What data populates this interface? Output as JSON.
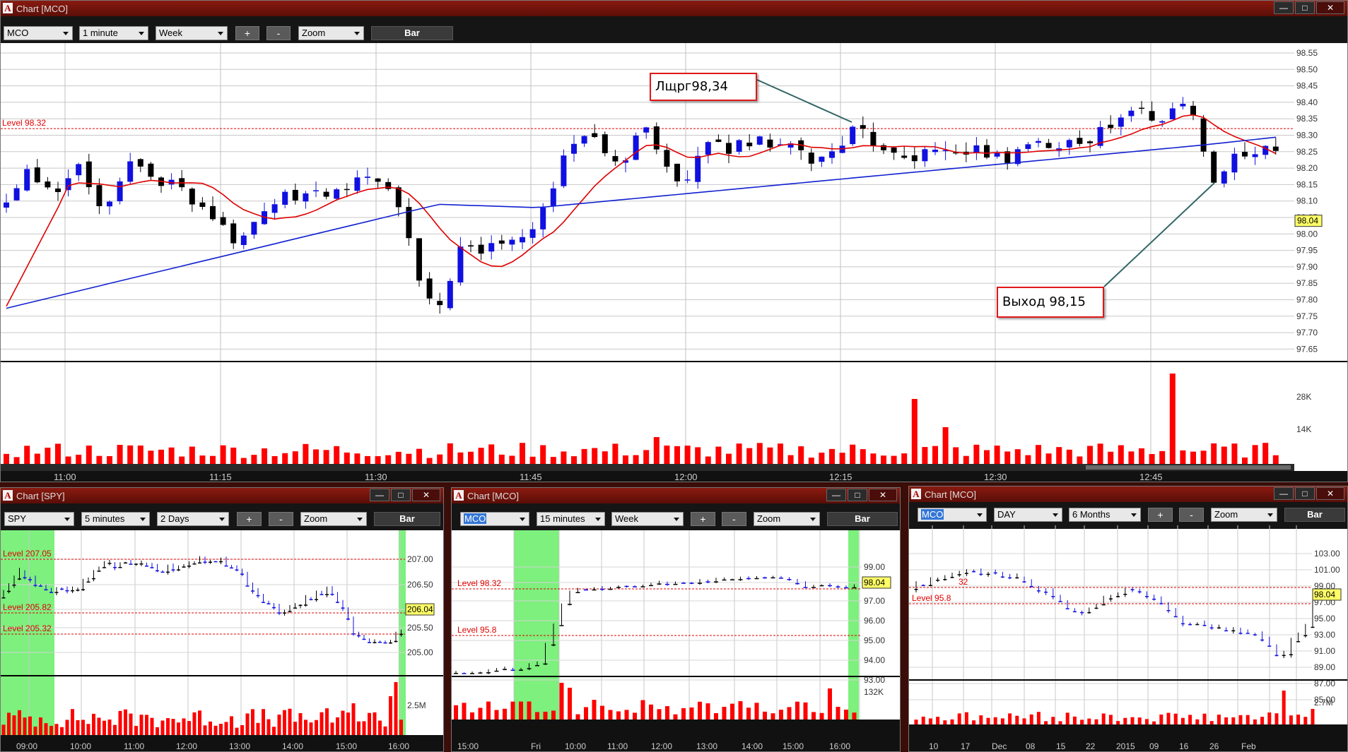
{
  "main": {
    "title": "Chart [MCO]",
    "symbol": "MCO",
    "interval": "1 minute",
    "range": "Week",
    "plus": "+",
    "minus": "-",
    "zoom": "Zoom",
    "bar": "Bar",
    "level_label": "Level 98.32",
    "price_labels": [
      "98.55",
      "98.50",
      "98.45",
      "98.40",
      "98.35",
      "98.30",
      "98.25",
      "98.20",
      "98.15",
      "98.10",
      "98.05",
      "98.00",
      "97.95",
      "97.90",
      "97.85",
      "97.80",
      "97.75",
      "97.70",
      "97.65"
    ],
    "current_price": "98.04",
    "volume_labels": [
      "28K",
      "14K"
    ],
    "time_labels": [
      "11:00",
      "11:15",
      "11:30",
      "11:45",
      "12:00",
      "12:15",
      "12:30",
      "12:45"
    ],
    "annotation_entry": "Лщрг98,34",
    "annotation_exit": "Выход 98,15"
  },
  "spy": {
    "title": "Chart [SPY]",
    "symbol": "SPY",
    "interval": "5 minutes",
    "range": "2 Days",
    "plus": "+",
    "minus": "-",
    "zoom": "Zoom",
    "bar": "Bar",
    "levels": [
      "Level 207.05",
      "Level 205.82",
      "Level 205.32"
    ],
    "price_labels": [
      "207.00",
      "206.50",
      "206.04",
      "205.50",
      "205.00"
    ],
    "current_price": "206.04",
    "volume_label": "2.5M",
    "time_labels": [
      "09:00",
      "10:00",
      "11:00",
      "12:00",
      "13:00",
      "14:00",
      "15:00",
      "16:00"
    ]
  },
  "mco15": {
    "title": "Chart [MCO]",
    "symbol": "MCO",
    "interval": "15 minutes",
    "range": "Week",
    "plus": "+",
    "minus": "-",
    "zoom": "Zoom",
    "bar": "Bar",
    "levels": [
      "Level 98.32",
      "Level 95.8"
    ],
    "price_labels": [
      "99.00",
      "98.04",
      "97.00",
      "96.00",
      "95.00",
      "94.00",
      "93.00"
    ],
    "current_price": "98.04",
    "volume_label": "132K",
    "time_labels": [
      "15:00",
      "Fri",
      "10:00",
      "11:00",
      "12:00",
      "13:00",
      "14:00",
      "15:00",
      "16:00"
    ]
  },
  "mcoday": {
    "title": "Chart [MCO]",
    "symbol": "MCO",
    "interval": "DAY",
    "range": "6 Months",
    "plus": "+",
    "minus": "-",
    "zoom": "Zoom",
    "bar": "Bar",
    "levels": [
      "Level 98.32",
      "Level 95.8"
    ],
    "level1_tail": "32",
    "price_labels": [
      "103.00",
      "101.00",
      "99.00",
      "97.00",
      "95.00",
      "93.00",
      "91.00",
      "89.00",
      "87.00",
      "85.00"
    ],
    "current_price": "98.04",
    "volume_label": "2.7M",
    "time_labels": [
      "10",
      "17",
      "Dec",
      "08",
      "15",
      "22",
      "2015",
      "09",
      "16",
      "26",
      "Feb"
    ]
  },
  "colors": {
    "bull": "#1010e0",
    "bear": "#000000",
    "ma_fast": "#e00000",
    "ma_slow": "#1020d0",
    "volume": "#ff0000",
    "level": "#e00000",
    "session": "#7df07d"
  }
}
